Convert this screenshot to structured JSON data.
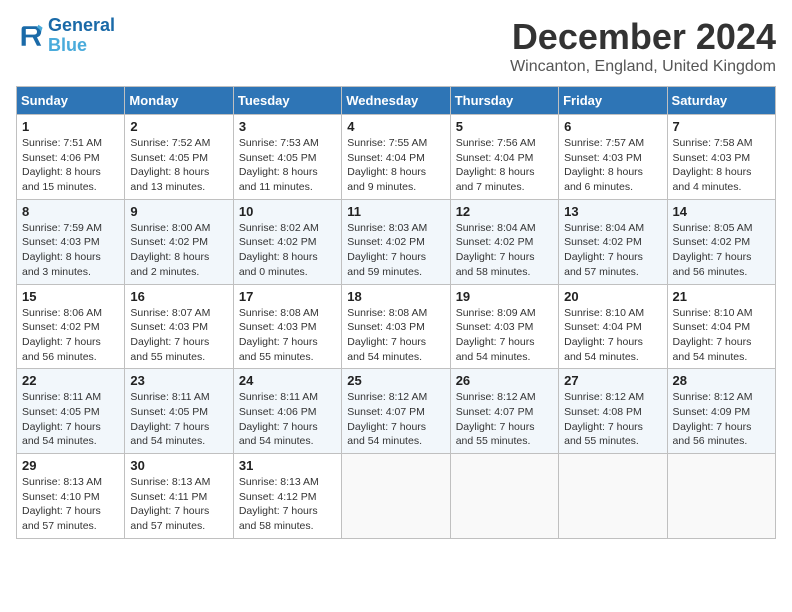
{
  "logo": {
    "line1": "General",
    "line2": "Blue"
  },
  "title": "December 2024",
  "location": "Wincanton, England, United Kingdom",
  "days_of_week": [
    "Sunday",
    "Monday",
    "Tuesday",
    "Wednesday",
    "Thursday",
    "Friday",
    "Saturday"
  ],
  "weeks": [
    [
      {
        "day": "1",
        "sunrise": "7:51 AM",
        "sunset": "4:06 PM",
        "daylight": "8 hours and 15 minutes."
      },
      {
        "day": "2",
        "sunrise": "7:52 AM",
        "sunset": "4:05 PM",
        "daylight": "8 hours and 13 minutes."
      },
      {
        "day": "3",
        "sunrise": "7:53 AM",
        "sunset": "4:05 PM",
        "daylight": "8 hours and 11 minutes."
      },
      {
        "day": "4",
        "sunrise": "7:55 AM",
        "sunset": "4:04 PM",
        "daylight": "8 hours and 9 minutes."
      },
      {
        "day": "5",
        "sunrise": "7:56 AM",
        "sunset": "4:04 PM",
        "daylight": "8 hours and 7 minutes."
      },
      {
        "day": "6",
        "sunrise": "7:57 AM",
        "sunset": "4:03 PM",
        "daylight": "8 hours and 6 minutes."
      },
      {
        "day": "7",
        "sunrise": "7:58 AM",
        "sunset": "4:03 PM",
        "daylight": "8 hours and 4 minutes."
      }
    ],
    [
      {
        "day": "8",
        "sunrise": "7:59 AM",
        "sunset": "4:03 PM",
        "daylight": "8 hours and 3 minutes."
      },
      {
        "day": "9",
        "sunrise": "8:00 AM",
        "sunset": "4:02 PM",
        "daylight": "8 hours and 2 minutes."
      },
      {
        "day": "10",
        "sunrise": "8:02 AM",
        "sunset": "4:02 PM",
        "daylight": "8 hours and 0 minutes."
      },
      {
        "day": "11",
        "sunrise": "8:03 AM",
        "sunset": "4:02 PM",
        "daylight": "7 hours and 59 minutes."
      },
      {
        "day": "12",
        "sunrise": "8:04 AM",
        "sunset": "4:02 PM",
        "daylight": "7 hours and 58 minutes."
      },
      {
        "day": "13",
        "sunrise": "8:04 AM",
        "sunset": "4:02 PM",
        "daylight": "7 hours and 57 minutes."
      },
      {
        "day": "14",
        "sunrise": "8:05 AM",
        "sunset": "4:02 PM",
        "daylight": "7 hours and 56 minutes."
      }
    ],
    [
      {
        "day": "15",
        "sunrise": "8:06 AM",
        "sunset": "4:02 PM",
        "daylight": "7 hours and 56 minutes."
      },
      {
        "day": "16",
        "sunrise": "8:07 AM",
        "sunset": "4:03 PM",
        "daylight": "7 hours and 55 minutes."
      },
      {
        "day": "17",
        "sunrise": "8:08 AM",
        "sunset": "4:03 PM",
        "daylight": "7 hours and 55 minutes."
      },
      {
        "day": "18",
        "sunrise": "8:08 AM",
        "sunset": "4:03 PM",
        "daylight": "7 hours and 54 minutes."
      },
      {
        "day": "19",
        "sunrise": "8:09 AM",
        "sunset": "4:03 PM",
        "daylight": "7 hours and 54 minutes."
      },
      {
        "day": "20",
        "sunrise": "8:10 AM",
        "sunset": "4:04 PM",
        "daylight": "7 hours and 54 minutes."
      },
      {
        "day": "21",
        "sunrise": "8:10 AM",
        "sunset": "4:04 PM",
        "daylight": "7 hours and 54 minutes."
      }
    ],
    [
      {
        "day": "22",
        "sunrise": "8:11 AM",
        "sunset": "4:05 PM",
        "daylight": "7 hours and 54 minutes."
      },
      {
        "day": "23",
        "sunrise": "8:11 AM",
        "sunset": "4:05 PM",
        "daylight": "7 hours and 54 minutes."
      },
      {
        "day": "24",
        "sunrise": "8:11 AM",
        "sunset": "4:06 PM",
        "daylight": "7 hours and 54 minutes."
      },
      {
        "day": "25",
        "sunrise": "8:12 AM",
        "sunset": "4:07 PM",
        "daylight": "7 hours and 54 minutes."
      },
      {
        "day": "26",
        "sunrise": "8:12 AM",
        "sunset": "4:07 PM",
        "daylight": "7 hours and 55 minutes."
      },
      {
        "day": "27",
        "sunrise": "8:12 AM",
        "sunset": "4:08 PM",
        "daylight": "7 hours and 55 minutes."
      },
      {
        "day": "28",
        "sunrise": "8:12 AM",
        "sunset": "4:09 PM",
        "daylight": "7 hours and 56 minutes."
      }
    ],
    [
      {
        "day": "29",
        "sunrise": "8:13 AM",
        "sunset": "4:10 PM",
        "daylight": "7 hours and 57 minutes."
      },
      {
        "day": "30",
        "sunrise": "8:13 AM",
        "sunset": "4:11 PM",
        "daylight": "7 hours and 57 minutes."
      },
      {
        "day": "31",
        "sunrise": "8:13 AM",
        "sunset": "4:12 PM",
        "daylight": "7 hours and 58 minutes."
      },
      null,
      null,
      null,
      null
    ]
  ]
}
